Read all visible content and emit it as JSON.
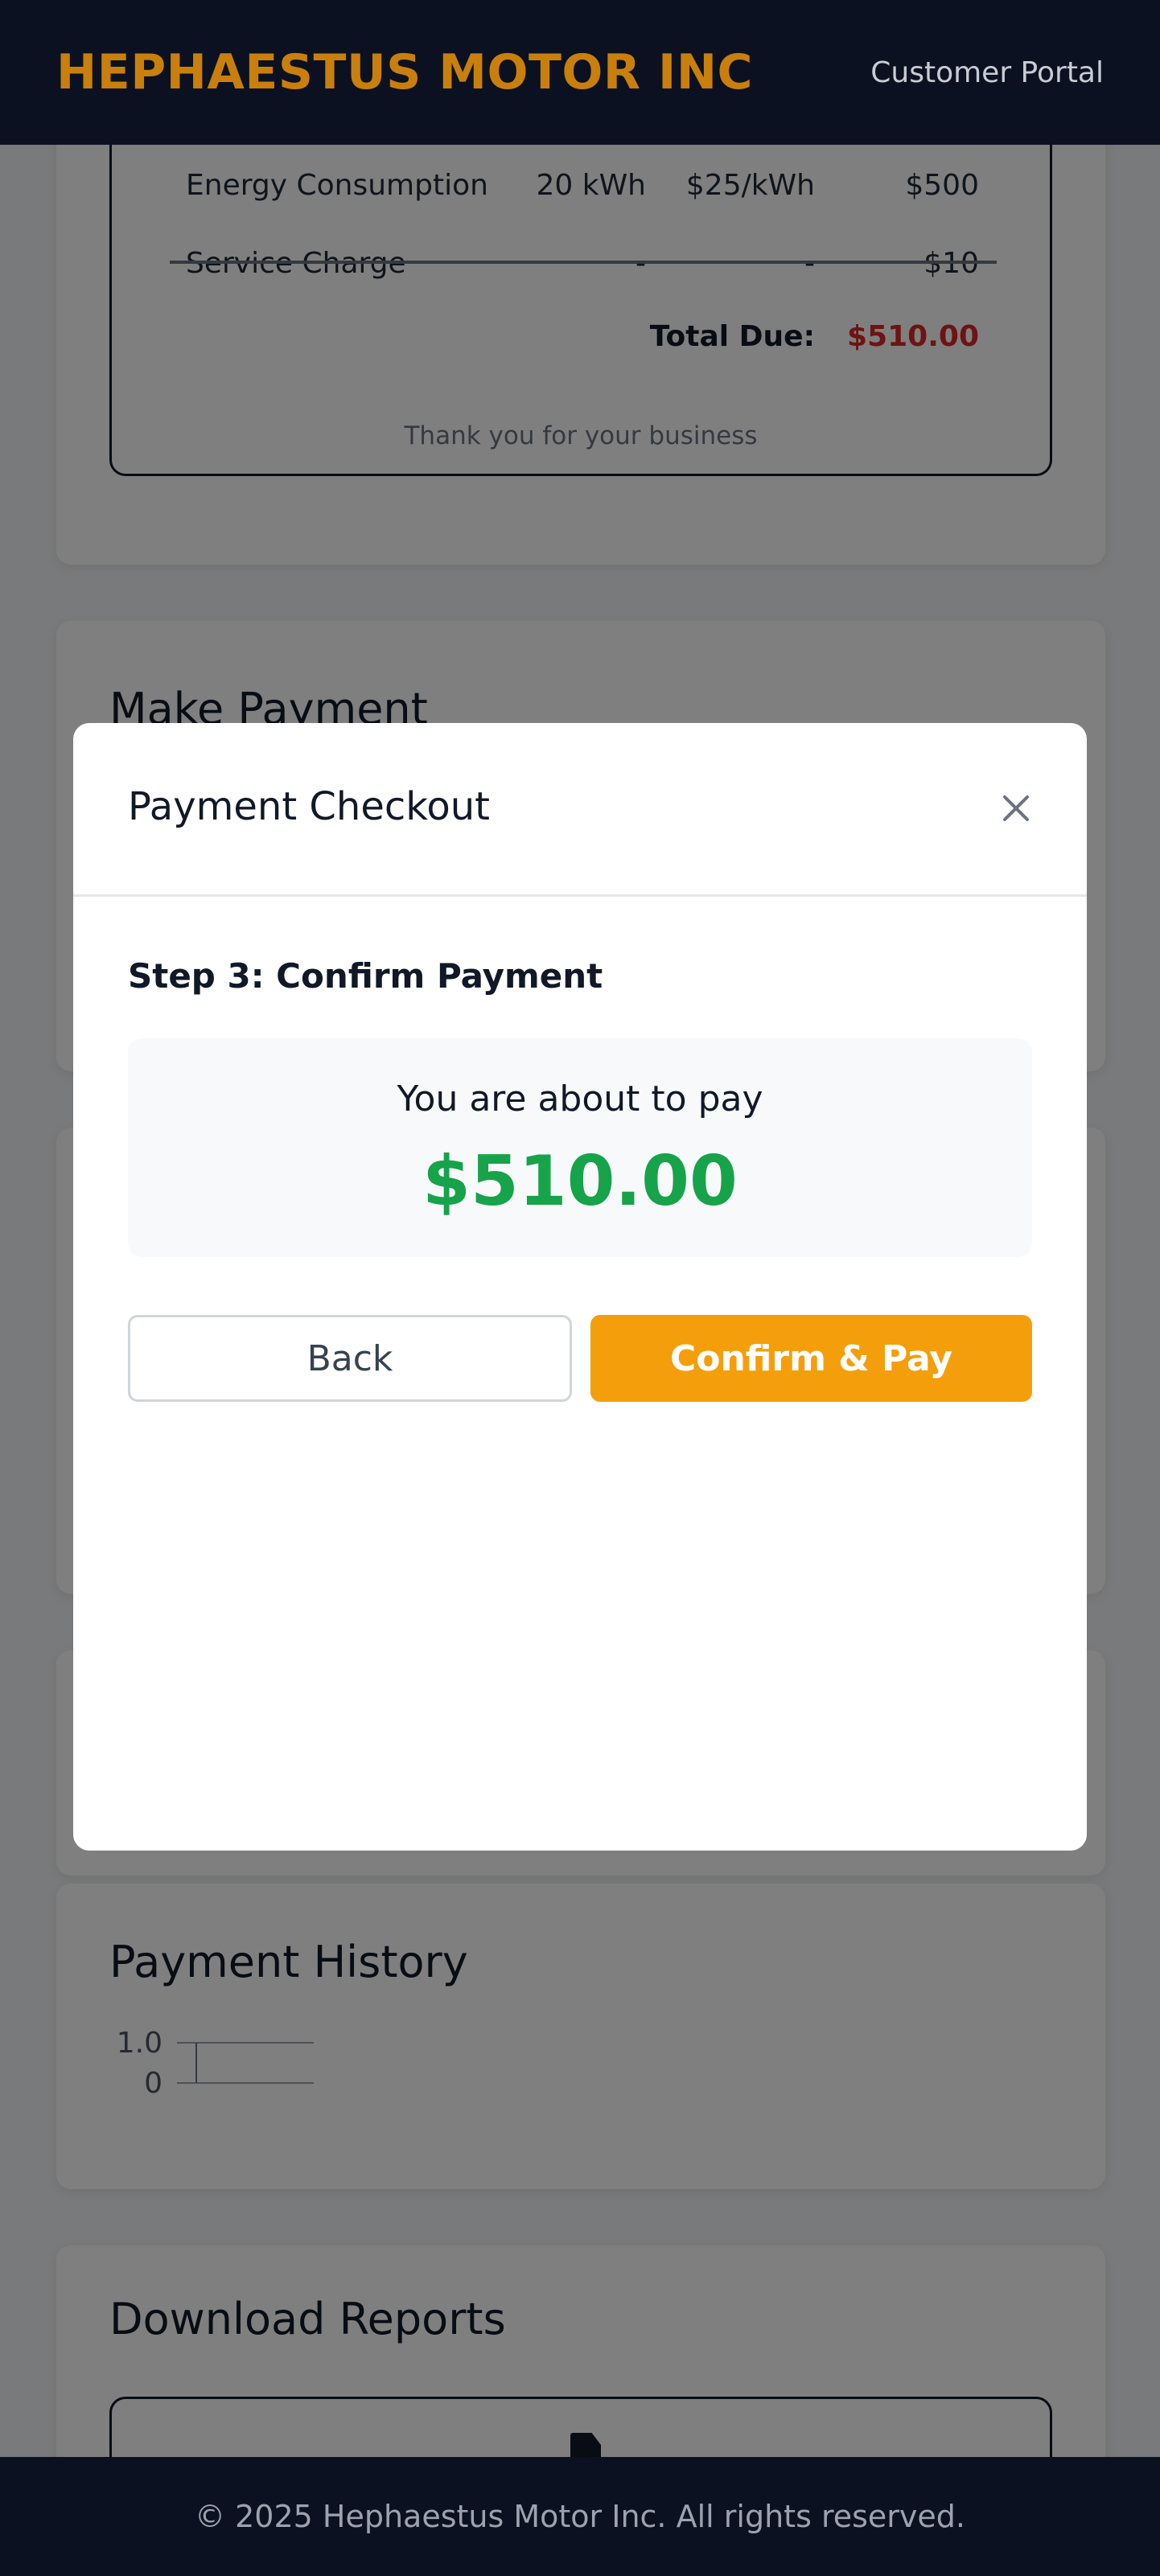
{
  "header": {
    "brand": "HEPHAESTUS MOTOR INC",
    "portal_link": "Customer Portal"
  },
  "invoice": {
    "rows": [
      {
        "description": "Energy Consumption",
        "quantity": "20 kWh",
        "rate": "$25/kWh",
        "amount": "$500"
      },
      {
        "description": "Service Charge",
        "quantity": "-",
        "rate": "-",
        "amount": "$10"
      }
    ],
    "total_label": "Total Due:",
    "total_value": "$510.00",
    "thanks": "Thank you for your business"
  },
  "make_payment": {
    "title": "Make Payment"
  },
  "payment_history": {
    "title": "Payment History",
    "chart_data": {
      "type": "line",
      "y_ticks": [
        "1.0",
        "0"
      ],
      "ylim": [
        0,
        1.0
      ],
      "series": [],
      "grid": true
    }
  },
  "download_reports": {
    "title": "Download Reports",
    "icon": "document-icon"
  },
  "modal": {
    "title": "Payment Checkout",
    "close_icon": "close-icon",
    "step_title": "Step 3: Confirm Payment",
    "summary_text": "You are about to pay",
    "amount": "$510.00",
    "back_label": "Back",
    "confirm_label": "Confirm & Pay"
  },
  "footer": {
    "copyright": "© 2025 Hephaestus Motor Inc. All rights reserved."
  },
  "colors": {
    "brand": "#c97f0c",
    "accent": "#f59e0b",
    "amount": "#16a34a",
    "total_due": "#dc2626",
    "nav_bg": "#0b1120"
  }
}
